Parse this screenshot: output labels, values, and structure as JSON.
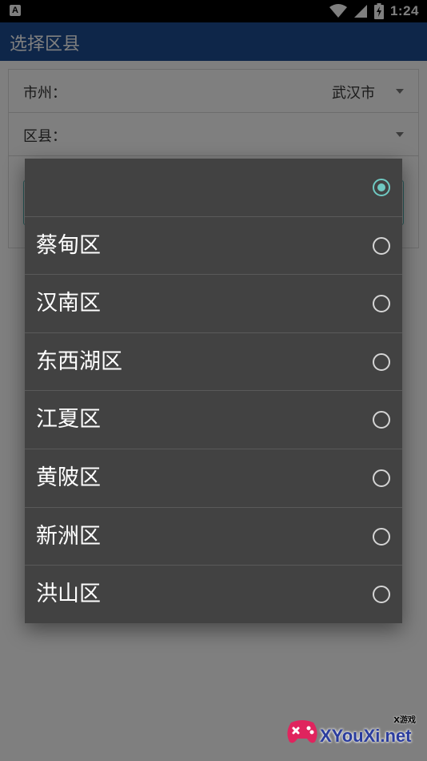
{
  "status_bar": {
    "app_badge": "A",
    "time": "1:24"
  },
  "title_bar": {
    "title": "选择区县"
  },
  "form": {
    "city_label": "市州：",
    "city_value": "武汉市",
    "county_label": "区县：",
    "county_value": ""
  },
  "dialog": {
    "options": [
      {
        "label": "",
        "checked": true
      },
      {
        "label": "蔡甸区",
        "checked": false
      },
      {
        "label": "汉南区",
        "checked": false
      },
      {
        "label": "东西湖区",
        "checked": false
      },
      {
        "label": "江夏区",
        "checked": false
      },
      {
        "label": "黄陂区",
        "checked": false
      },
      {
        "label": "新洲区",
        "checked": false
      },
      {
        "label": "洪山区",
        "checked": false
      }
    ]
  },
  "watermark": {
    "text": "XYouXi.net",
    "sub": "X游戏"
  },
  "colors": {
    "title_bar": "#1c4c92",
    "dialog_bg": "#424242",
    "radio_checked": "#6fc9c2",
    "dim": "rgba(0,0,0,0.5)"
  }
}
